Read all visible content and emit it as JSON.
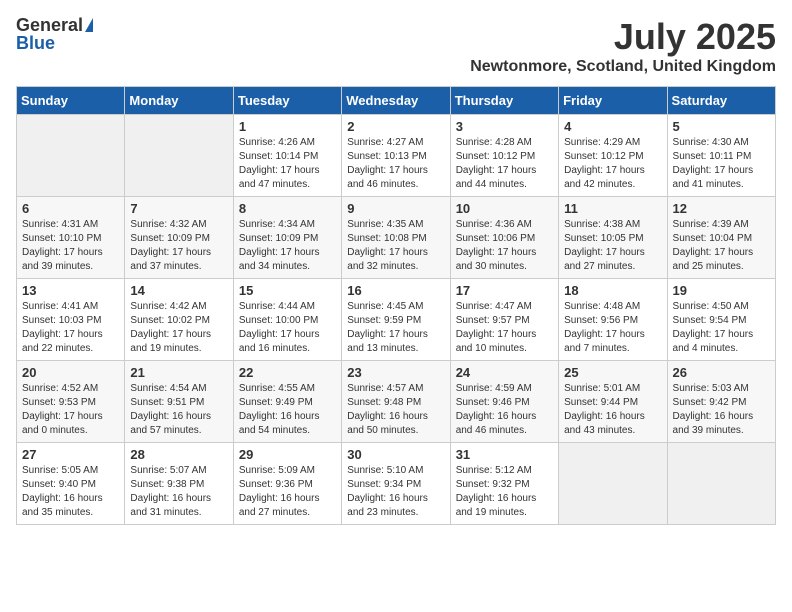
{
  "header": {
    "logo_general": "General",
    "logo_blue": "Blue",
    "month_title": "July 2025",
    "location": "Newtonmore, Scotland, United Kingdom"
  },
  "days_of_week": [
    "Sunday",
    "Monday",
    "Tuesday",
    "Wednesday",
    "Thursday",
    "Friday",
    "Saturday"
  ],
  "weeks": [
    [
      {
        "day": "",
        "info": ""
      },
      {
        "day": "",
        "info": ""
      },
      {
        "day": "1",
        "info": "Sunrise: 4:26 AM\nSunset: 10:14 PM\nDaylight: 17 hours and 47 minutes."
      },
      {
        "day": "2",
        "info": "Sunrise: 4:27 AM\nSunset: 10:13 PM\nDaylight: 17 hours and 46 minutes."
      },
      {
        "day": "3",
        "info": "Sunrise: 4:28 AM\nSunset: 10:12 PM\nDaylight: 17 hours and 44 minutes."
      },
      {
        "day": "4",
        "info": "Sunrise: 4:29 AM\nSunset: 10:12 PM\nDaylight: 17 hours and 42 minutes."
      },
      {
        "day": "5",
        "info": "Sunrise: 4:30 AM\nSunset: 10:11 PM\nDaylight: 17 hours and 41 minutes."
      }
    ],
    [
      {
        "day": "6",
        "info": "Sunrise: 4:31 AM\nSunset: 10:10 PM\nDaylight: 17 hours and 39 minutes."
      },
      {
        "day": "7",
        "info": "Sunrise: 4:32 AM\nSunset: 10:09 PM\nDaylight: 17 hours and 37 minutes."
      },
      {
        "day": "8",
        "info": "Sunrise: 4:34 AM\nSunset: 10:09 PM\nDaylight: 17 hours and 34 minutes."
      },
      {
        "day": "9",
        "info": "Sunrise: 4:35 AM\nSunset: 10:08 PM\nDaylight: 17 hours and 32 minutes."
      },
      {
        "day": "10",
        "info": "Sunrise: 4:36 AM\nSunset: 10:06 PM\nDaylight: 17 hours and 30 minutes."
      },
      {
        "day": "11",
        "info": "Sunrise: 4:38 AM\nSunset: 10:05 PM\nDaylight: 17 hours and 27 minutes."
      },
      {
        "day": "12",
        "info": "Sunrise: 4:39 AM\nSunset: 10:04 PM\nDaylight: 17 hours and 25 minutes."
      }
    ],
    [
      {
        "day": "13",
        "info": "Sunrise: 4:41 AM\nSunset: 10:03 PM\nDaylight: 17 hours and 22 minutes."
      },
      {
        "day": "14",
        "info": "Sunrise: 4:42 AM\nSunset: 10:02 PM\nDaylight: 17 hours and 19 minutes."
      },
      {
        "day": "15",
        "info": "Sunrise: 4:44 AM\nSunset: 10:00 PM\nDaylight: 17 hours and 16 minutes."
      },
      {
        "day": "16",
        "info": "Sunrise: 4:45 AM\nSunset: 9:59 PM\nDaylight: 17 hours and 13 minutes."
      },
      {
        "day": "17",
        "info": "Sunrise: 4:47 AM\nSunset: 9:57 PM\nDaylight: 17 hours and 10 minutes."
      },
      {
        "day": "18",
        "info": "Sunrise: 4:48 AM\nSunset: 9:56 PM\nDaylight: 17 hours and 7 minutes."
      },
      {
        "day": "19",
        "info": "Sunrise: 4:50 AM\nSunset: 9:54 PM\nDaylight: 17 hours and 4 minutes."
      }
    ],
    [
      {
        "day": "20",
        "info": "Sunrise: 4:52 AM\nSunset: 9:53 PM\nDaylight: 17 hours and 0 minutes."
      },
      {
        "day": "21",
        "info": "Sunrise: 4:54 AM\nSunset: 9:51 PM\nDaylight: 16 hours and 57 minutes."
      },
      {
        "day": "22",
        "info": "Sunrise: 4:55 AM\nSunset: 9:49 PM\nDaylight: 16 hours and 54 minutes."
      },
      {
        "day": "23",
        "info": "Sunrise: 4:57 AM\nSunset: 9:48 PM\nDaylight: 16 hours and 50 minutes."
      },
      {
        "day": "24",
        "info": "Sunrise: 4:59 AM\nSunset: 9:46 PM\nDaylight: 16 hours and 46 minutes."
      },
      {
        "day": "25",
        "info": "Sunrise: 5:01 AM\nSunset: 9:44 PM\nDaylight: 16 hours and 43 minutes."
      },
      {
        "day": "26",
        "info": "Sunrise: 5:03 AM\nSunset: 9:42 PM\nDaylight: 16 hours and 39 minutes."
      }
    ],
    [
      {
        "day": "27",
        "info": "Sunrise: 5:05 AM\nSunset: 9:40 PM\nDaylight: 16 hours and 35 minutes."
      },
      {
        "day": "28",
        "info": "Sunrise: 5:07 AM\nSunset: 9:38 PM\nDaylight: 16 hours and 31 minutes."
      },
      {
        "day": "29",
        "info": "Sunrise: 5:09 AM\nSunset: 9:36 PM\nDaylight: 16 hours and 27 minutes."
      },
      {
        "day": "30",
        "info": "Sunrise: 5:10 AM\nSunset: 9:34 PM\nDaylight: 16 hours and 23 minutes."
      },
      {
        "day": "31",
        "info": "Sunrise: 5:12 AM\nSunset: 9:32 PM\nDaylight: 16 hours and 19 minutes."
      },
      {
        "day": "",
        "info": ""
      },
      {
        "day": "",
        "info": ""
      }
    ]
  ]
}
